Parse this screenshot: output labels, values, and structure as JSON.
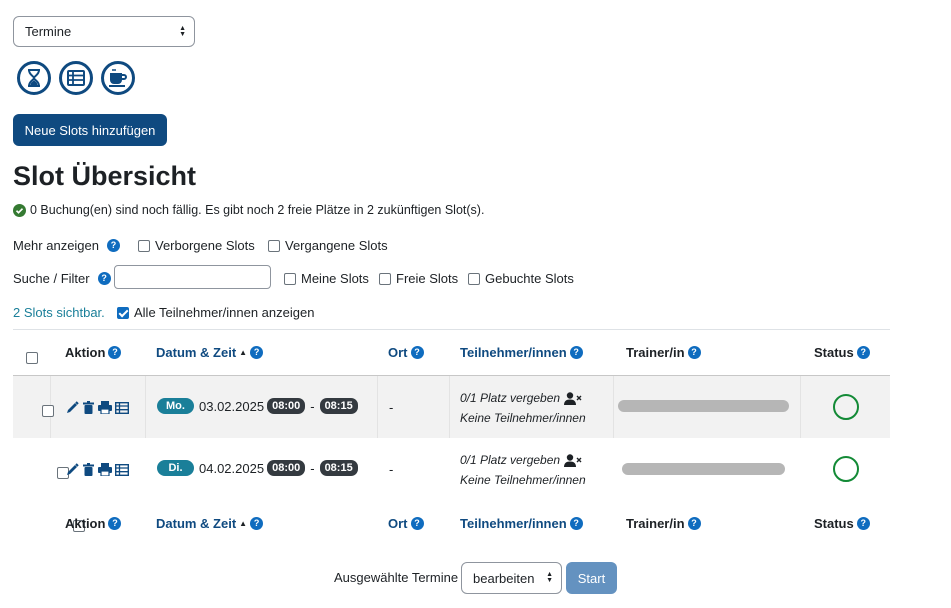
{
  "view_select": {
    "value": "Termine"
  },
  "toolbar_icons": [
    "hourglass-icon",
    "list-icon",
    "coffee-cup-icon"
  ],
  "add_button": {
    "label": "Neue Slots hinzufügen"
  },
  "page_title": "Slot Übersicht",
  "status_message": "0 Buchung(en) sind noch fällig. Es gibt noch 2 freie Plätze in 2 zukünftigen Slot(s).",
  "filters": {
    "mehr_anzeigen_label": "Mehr anzeigen",
    "verborgene_label": "Verborgene Slots",
    "vergangene_label": "Vergangene Slots",
    "suche_label": "Suche / Filter",
    "suche_value": "",
    "meine_label": "Meine Slots",
    "freie_label": "Freie Slots",
    "gebuchte_label": "Gebuchte Slots",
    "visible_count": "2 Slots sichtbar.",
    "alle_teilnehmer_label": "Alle Teilnehmer/innen anzeigen",
    "alle_teilnehmer_checked": true
  },
  "table": {
    "headers": {
      "aktion": "Aktion",
      "datum": "Datum & Zeit",
      "ort": "Ort",
      "teilnehmer": "Teilnehmer/innen",
      "trainer": "Trainer/in",
      "status": "Status"
    },
    "rows": [
      {
        "day": "Mo.",
        "date": "03.02.2025",
        "start": "08:00",
        "sep": "-",
        "end": "08:15",
        "ort": "-",
        "places": "0/1 Platz vergeben",
        "participants": "Keine Teilnehmer/innen"
      },
      {
        "day": "Di.",
        "date": "04.02.2025",
        "start": "08:00",
        "sep": "-",
        "end": "08:15",
        "ort": "-",
        "places": "0/1 Platz vergeben",
        "participants": "Keine Teilnehmer/innen"
      }
    ]
  },
  "bulk": {
    "label": "Ausgewählte Termine",
    "select_value": "bearbeiten",
    "start_label": "Start"
  },
  "colors": {
    "primary": "#0f4a80",
    "badge_day": "#1a7f99",
    "status_ring": "#138a36"
  }
}
